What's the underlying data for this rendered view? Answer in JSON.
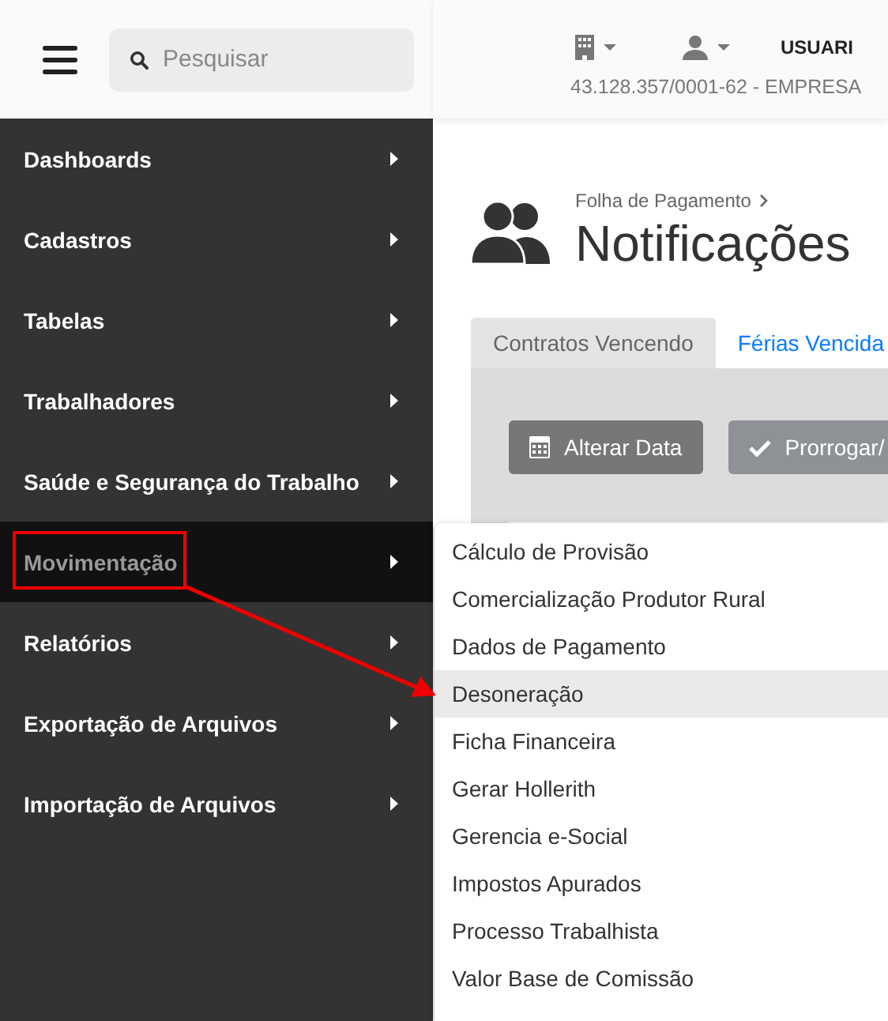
{
  "header": {
    "search": {
      "placeholder": "Pesquisar"
    },
    "user": "USUARI",
    "company": "43.128.357/0001-62 - EMPRESA"
  },
  "sidebar": {
    "items": [
      {
        "label": "Dashboards",
        "selected": false
      },
      {
        "label": "Cadastros",
        "selected": false
      },
      {
        "label": "Tabelas",
        "selected": false
      },
      {
        "label": "Trabalhadores",
        "selected": false
      },
      {
        "label": "Saúde e Segurança do Trabalho",
        "selected": false
      },
      {
        "label": "Movimentação",
        "selected": true
      },
      {
        "label": "Relatórios",
        "selected": false
      },
      {
        "label": "Exportação de Arquivos",
        "selected": false
      },
      {
        "label": "Importação de Arquivos",
        "selected": false
      }
    ]
  },
  "breadcrumb": "Folha de Pagamento",
  "title": "Notificações",
  "tabs": [
    {
      "label": "Contratos Vencendo",
      "selected": true
    },
    {
      "label": "Férias Vencida",
      "selected": false
    }
  ],
  "buttons": [
    {
      "label": "Alterar Data",
      "kind": "calendar"
    },
    {
      "label": "Prorrogar/",
      "kind": "check"
    }
  ],
  "submenu": {
    "items": [
      {
        "label": "Cálculo de Provisão",
        "selected": false
      },
      {
        "label": "Comercialização Produtor Rural",
        "selected": false
      },
      {
        "label": "Dados de Pagamento",
        "selected": false
      },
      {
        "label": "Desoneração",
        "selected": true
      },
      {
        "label": "Ficha Financeira",
        "selected": false
      },
      {
        "label": "Gerar Hollerith",
        "selected": false
      },
      {
        "label": "Gerencia e-Social",
        "selected": false
      },
      {
        "label": "Impostos Apurados",
        "selected": false
      },
      {
        "label": "Processo Trabalhista",
        "selected": false
      },
      {
        "label": "Valor Base de Comissão",
        "selected": false
      }
    ]
  }
}
